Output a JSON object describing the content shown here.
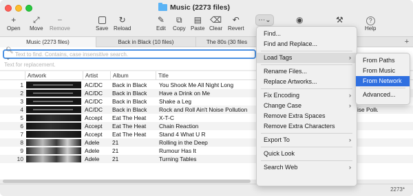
{
  "window": {
    "title": "Music (2273 files)"
  },
  "toolbar": [
    {
      "id": "open",
      "label": "Open",
      "icon": "+"
    },
    {
      "id": "move",
      "label": "Move",
      "icon": "⤢"
    },
    {
      "id": "remove",
      "label": "Remove",
      "icon": "−"
    },
    {
      "id": "save",
      "label": "Save",
      "icon": "save-icon"
    },
    {
      "id": "reload",
      "label": "Reload",
      "icon": "↻"
    },
    {
      "id": "edit",
      "label": "Edit",
      "icon": "✎"
    },
    {
      "id": "copy",
      "label": "Copy",
      "icon": "⧉"
    },
    {
      "id": "paste",
      "label": "Paste",
      "icon": "📋"
    },
    {
      "id": "clear",
      "label": "Clear",
      "icon": "⌫"
    },
    {
      "id": "revert",
      "label": "Revert",
      "icon": "↶"
    },
    {
      "id": "view",
      "label": "",
      "icon": "◉"
    },
    {
      "id": "settings",
      "label": "",
      "icon": "🔧"
    },
    {
      "id": "help",
      "label": "Help",
      "icon": "?"
    }
  ],
  "tabs": [
    {
      "label": "Music (2273 files)",
      "active": true
    },
    {
      "label": "Back in Black (10 files)",
      "active": false
    },
    {
      "label": "The 80s (30 files",
      "active": false
    }
  ],
  "tabs_add": "+",
  "search": {
    "find_placeholder": "Text to find. Contains, case insensitive search.",
    "replace_placeholder": "Text for replacement."
  },
  "table": {
    "columns": [
      "Artwork",
      "Artist",
      "Album",
      "Title"
    ],
    "rows": [
      {
        "num": "1",
        "art": "acdc",
        "artist": "AC/DC",
        "album": "Back in Black",
        "title": "You Shook Me All Night Long"
      },
      {
        "num": "2",
        "art": "acdc",
        "artist": "AC/DC",
        "album": "Back in Black",
        "title": "Have a Drink on Me"
      },
      {
        "num": "3",
        "art": "acdc",
        "artist": "AC/DC",
        "album": "Back in Black",
        "title": "Shake a Leg"
      },
      {
        "num": "4",
        "art": "acdc",
        "artist": "AC/DC",
        "album": "Back in Black",
        "title": "Rock and Roll Ain't Noise Pollution",
        "extra": "ise Pollution"
      },
      {
        "num": "5",
        "art": "accept",
        "artist": "Accept",
        "album": "Eat The Heat",
        "title": "X-T-C"
      },
      {
        "num": "6",
        "art": "accept",
        "artist": "Accept",
        "album": "Eat The Heat",
        "title": "Chain Reaction"
      },
      {
        "num": "7",
        "art": "accept",
        "artist": "Accept",
        "album": "Eat The Heat",
        "title": "Stand 4 What U R"
      },
      {
        "num": "8",
        "art": "adele",
        "artist": "Adele",
        "album": "21",
        "title": "Rolling in the Deep"
      },
      {
        "num": "9",
        "art": "adele",
        "artist": "Adele",
        "album": "21",
        "title": "Rumour Has It"
      },
      {
        "num": "10",
        "art": "adele",
        "artist": "Adele",
        "album": "21",
        "title": "Turning Tables"
      }
    ]
  },
  "status": {
    "count": "2273*"
  },
  "main_menu": {
    "items": [
      {
        "label": "Find...",
        "submenu": false
      },
      {
        "label": "Find and Replace...",
        "submenu": false
      },
      {
        "sep": true
      },
      {
        "label": "Load Tags",
        "submenu": true,
        "highlight": true
      },
      {
        "sep": true
      },
      {
        "label": "Rename Files...",
        "submenu": false
      },
      {
        "label": "Replace Artworks...",
        "submenu": false
      },
      {
        "sep": true
      },
      {
        "label": "Fix Encoding",
        "submenu": true
      },
      {
        "label": "Change Case",
        "submenu": true
      },
      {
        "label": "Remove Extra Spaces",
        "submenu": false
      },
      {
        "label": "Remove Extra Characters",
        "submenu": false
      },
      {
        "sep": true
      },
      {
        "label": "Export To",
        "submenu": true
      },
      {
        "sep": true
      },
      {
        "label": "Quick Look",
        "submenu": false
      },
      {
        "sep": true
      },
      {
        "label": "Search Web",
        "submenu": true
      }
    ]
  },
  "load_tags_submenu": {
    "items": [
      {
        "label": "From Paths"
      },
      {
        "label": "From Music"
      },
      {
        "label": "From Network",
        "selected": true
      },
      {
        "sep": true
      },
      {
        "label": "Advanced..."
      }
    ]
  },
  "colors": {
    "selection": "#2f6fe0",
    "search_focus": "#4a90e2"
  }
}
